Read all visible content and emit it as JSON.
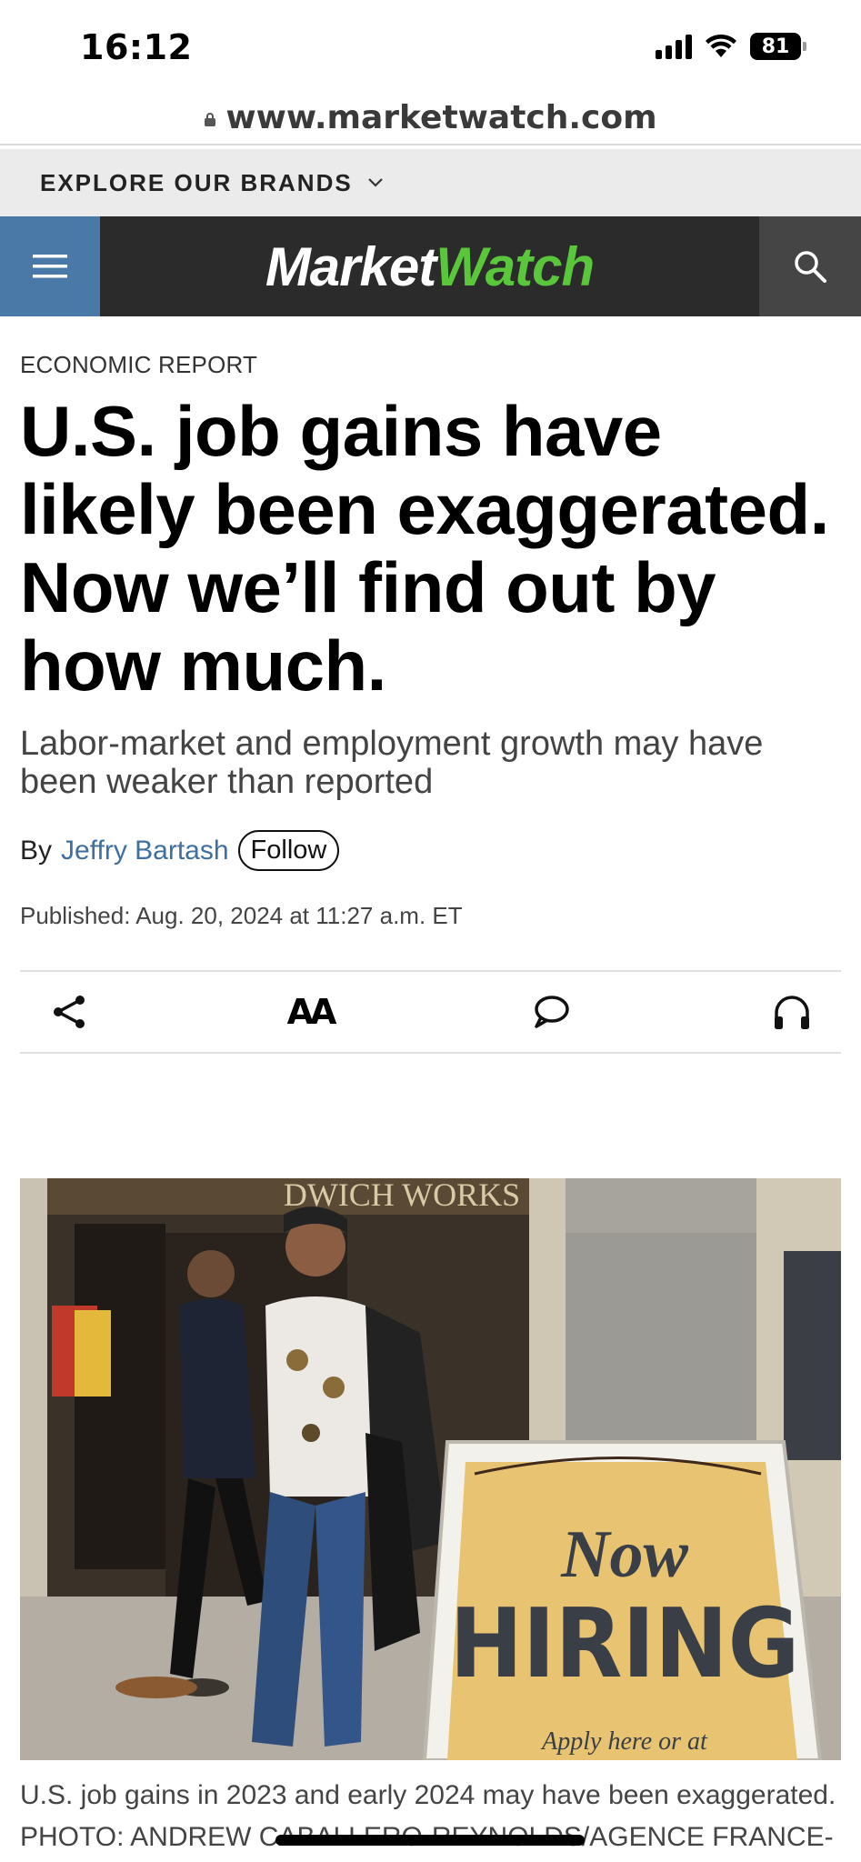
{
  "status_bar": {
    "time": "16:12",
    "battery": "81"
  },
  "browser": {
    "url": "www.marketwatch.com"
  },
  "brands": {
    "label": "EXPLORE OUR BRANDS"
  },
  "nav": {
    "logo_part1": "Market",
    "logo_part2": "Watch",
    "accent_color": "#5ac63c",
    "menu_color": "#4a79a8"
  },
  "article": {
    "kicker": "ECONOMIC REPORT",
    "headline": "U.S. job gains have likely been exaggerated. Now we’ll find out by how much.",
    "dek": "Labor-market and employment growth may have been weaker than reported",
    "byline_prefix": "By",
    "author": "Jeffry Bartash",
    "follow_label": "Follow",
    "published": "Published: Aug. 20, 2024 at 11:27 a.m. ET",
    "tools": {
      "share_icon": "share-icon",
      "text_size_label": "AA",
      "comment_icon": "comment-icon",
      "listen_icon": "headphones-icon"
    },
    "photo": {
      "storefront_sign": "DWICH WORKS",
      "sign_word1": "Now",
      "sign_word2": "HIRING",
      "sign_subtext": "Apply here or at"
    },
    "caption": "U.S. job gains in 2023 and early 2024 may have been exaggerated.",
    "credit": "PHOTO: ANDREW CABALLERO-REYNOLDS/AGENCE FRANCE-"
  }
}
